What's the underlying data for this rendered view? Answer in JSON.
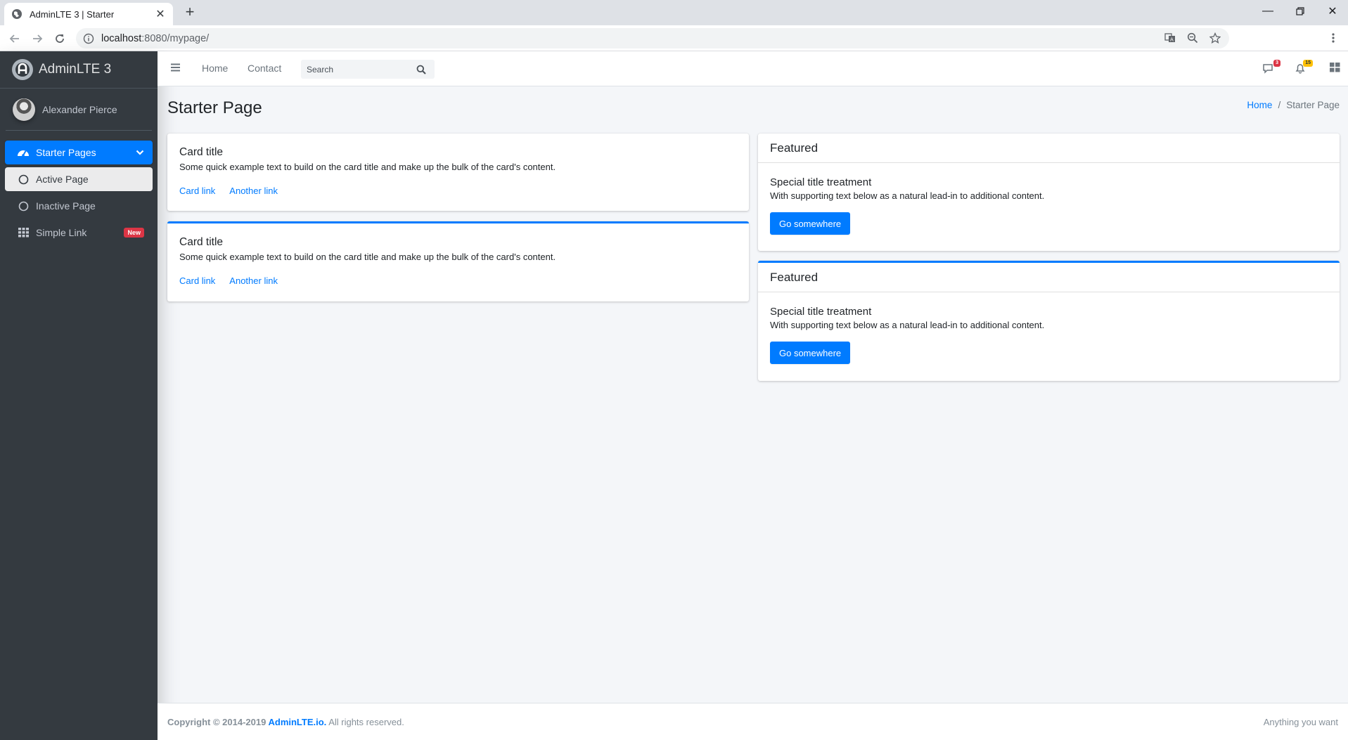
{
  "browser": {
    "tab_title": "AdminLTE 3 | Starter",
    "url_host": "localhost",
    "url_path": ":8080/mypage/"
  },
  "sidebar": {
    "brand": "AdminLTE 3",
    "user_name": "Alexander Pierce",
    "items": [
      {
        "label": "Starter Pages",
        "icon": "tachometer-icon"
      },
      {
        "label": "Active Page",
        "icon": "circle-icon"
      },
      {
        "label": "Inactive Page",
        "icon": "circle-icon"
      },
      {
        "label": "Simple Link",
        "icon": "grid-icon",
        "badge": "New"
      }
    ]
  },
  "header": {
    "nav": [
      "Home",
      "Contact"
    ],
    "search_placeholder": "Search",
    "messages_count": "3",
    "notifications_count": "15"
  },
  "content": {
    "page_title": "Starter Page",
    "breadcrumb": [
      "Home",
      "Starter Page"
    ],
    "left_cards": [
      {
        "title": "Card title",
        "text": "Some quick example text to build on the card title and make up the bulk of the card's content.",
        "link1": "Card link",
        "link2": "Another link"
      },
      {
        "title": "Card title",
        "text": "Some quick example text to build on the card title and make up the bulk of the card's content.",
        "link1": "Card link",
        "link2": "Another link"
      }
    ],
    "right_cards": [
      {
        "header": "Featured",
        "title": "Special title treatment",
        "text": "With supporting text below as a natural lead-in to additional content.",
        "button": "Go somewhere"
      },
      {
        "header": "Featured",
        "title": "Special title treatment",
        "text": "With supporting text below as a natural lead-in to additional content.",
        "button": "Go somewhere"
      }
    ]
  },
  "footer": {
    "copyright_prefix": "Copyright © 2014-2019 ",
    "copyright_link": "AdminLTE.io.",
    "copyright_suffix": " All rights reserved.",
    "right_text": "Anything you want"
  },
  "colors": {
    "primary": "#007bff",
    "sidebar_bg": "#343a40",
    "danger": "#dc3545",
    "warning": "#ffc107"
  }
}
